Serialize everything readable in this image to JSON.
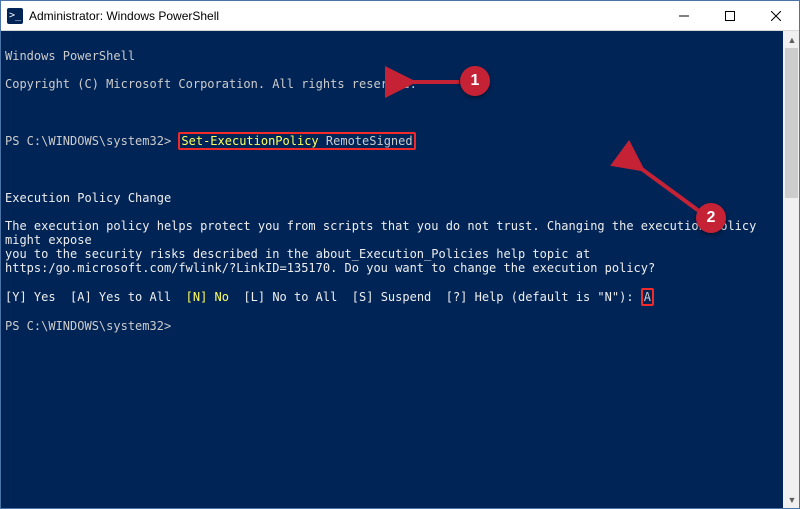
{
  "titlebar": {
    "title": "Administrator: Windows PowerShell"
  },
  "term": {
    "banner1": "Windows PowerShell",
    "banner2": "Copyright (C) Microsoft Corporation. All rights reserved.",
    "prompt1_prefix": "PS C:\\WINDOWS\\system32> ",
    "cmd_part1": "Set-ExecutionPolicy ",
    "cmd_part2": "RemoteSigned",
    "confirm_title": "Execution Policy Change",
    "confirm_body": "The execution policy helps protect you from scripts that you do not trust. Changing the execution policy might expose\nyou to the security risks described in the about_Execution_Policies help topic at\nhttps:/go.microsoft.com/fwlink/?LinkID=135170. Do you want to change the execution policy?",
    "opt_y": "[Y] Yes  ",
    "opt_a": "[A] Yes to All  ",
    "opt_n": "[N] No  ",
    "opt_l": "[L] No to All  ",
    "opt_s": "[S] Suspend  ",
    "opt_h": "[?] Help (default is \"N\"): ",
    "answer": "A",
    "prompt2": "PS C:\\WINDOWS\\system32>"
  },
  "annot": {
    "badge1": "1",
    "badge2": "2"
  }
}
